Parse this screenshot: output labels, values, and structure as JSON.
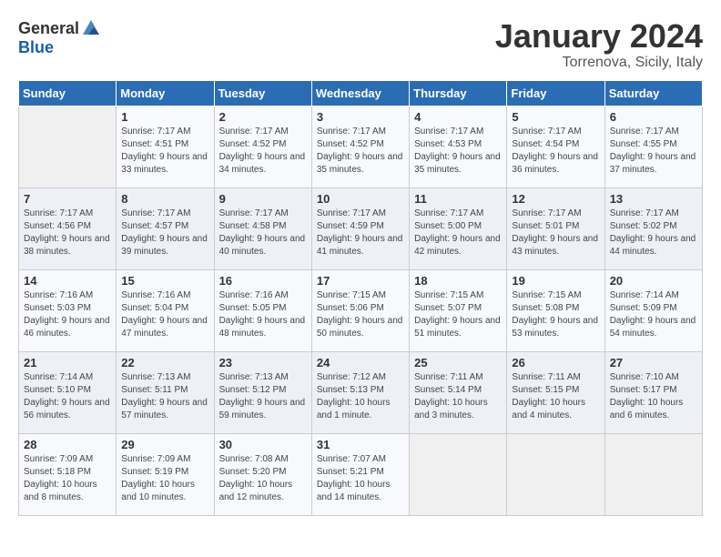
{
  "header": {
    "logo_general": "General",
    "logo_blue": "Blue",
    "month": "January 2024",
    "location": "Torrenova, Sicily, Italy"
  },
  "days_of_week": [
    "Sunday",
    "Monday",
    "Tuesday",
    "Wednesday",
    "Thursday",
    "Friday",
    "Saturday"
  ],
  "weeks": [
    [
      {
        "day": "",
        "sunrise": "",
        "sunset": "",
        "daylight": ""
      },
      {
        "day": "1",
        "sunrise": "Sunrise: 7:17 AM",
        "sunset": "Sunset: 4:51 PM",
        "daylight": "Daylight: 9 hours and 33 minutes."
      },
      {
        "day": "2",
        "sunrise": "Sunrise: 7:17 AM",
        "sunset": "Sunset: 4:52 PM",
        "daylight": "Daylight: 9 hours and 34 minutes."
      },
      {
        "day": "3",
        "sunrise": "Sunrise: 7:17 AM",
        "sunset": "Sunset: 4:52 PM",
        "daylight": "Daylight: 9 hours and 35 minutes."
      },
      {
        "day": "4",
        "sunrise": "Sunrise: 7:17 AM",
        "sunset": "Sunset: 4:53 PM",
        "daylight": "Daylight: 9 hours and 35 minutes."
      },
      {
        "day": "5",
        "sunrise": "Sunrise: 7:17 AM",
        "sunset": "Sunset: 4:54 PM",
        "daylight": "Daylight: 9 hours and 36 minutes."
      },
      {
        "day": "6",
        "sunrise": "Sunrise: 7:17 AM",
        "sunset": "Sunset: 4:55 PM",
        "daylight": "Daylight: 9 hours and 37 minutes."
      }
    ],
    [
      {
        "day": "7",
        "sunrise": "Sunrise: 7:17 AM",
        "sunset": "Sunset: 4:56 PM",
        "daylight": "Daylight: 9 hours and 38 minutes."
      },
      {
        "day": "8",
        "sunrise": "Sunrise: 7:17 AM",
        "sunset": "Sunset: 4:57 PM",
        "daylight": "Daylight: 9 hours and 39 minutes."
      },
      {
        "day": "9",
        "sunrise": "Sunrise: 7:17 AM",
        "sunset": "Sunset: 4:58 PM",
        "daylight": "Daylight: 9 hours and 40 minutes."
      },
      {
        "day": "10",
        "sunrise": "Sunrise: 7:17 AM",
        "sunset": "Sunset: 4:59 PM",
        "daylight": "Daylight: 9 hours and 41 minutes."
      },
      {
        "day": "11",
        "sunrise": "Sunrise: 7:17 AM",
        "sunset": "Sunset: 5:00 PM",
        "daylight": "Daylight: 9 hours and 42 minutes."
      },
      {
        "day": "12",
        "sunrise": "Sunrise: 7:17 AM",
        "sunset": "Sunset: 5:01 PM",
        "daylight": "Daylight: 9 hours and 43 minutes."
      },
      {
        "day": "13",
        "sunrise": "Sunrise: 7:17 AM",
        "sunset": "Sunset: 5:02 PM",
        "daylight": "Daylight: 9 hours and 44 minutes."
      }
    ],
    [
      {
        "day": "14",
        "sunrise": "Sunrise: 7:16 AM",
        "sunset": "Sunset: 5:03 PM",
        "daylight": "Daylight: 9 hours and 46 minutes."
      },
      {
        "day": "15",
        "sunrise": "Sunrise: 7:16 AM",
        "sunset": "Sunset: 5:04 PM",
        "daylight": "Daylight: 9 hours and 47 minutes."
      },
      {
        "day": "16",
        "sunrise": "Sunrise: 7:16 AM",
        "sunset": "Sunset: 5:05 PM",
        "daylight": "Daylight: 9 hours and 48 minutes."
      },
      {
        "day": "17",
        "sunrise": "Sunrise: 7:15 AM",
        "sunset": "Sunset: 5:06 PM",
        "daylight": "Daylight: 9 hours and 50 minutes."
      },
      {
        "day": "18",
        "sunrise": "Sunrise: 7:15 AM",
        "sunset": "Sunset: 5:07 PM",
        "daylight": "Daylight: 9 hours and 51 minutes."
      },
      {
        "day": "19",
        "sunrise": "Sunrise: 7:15 AM",
        "sunset": "Sunset: 5:08 PM",
        "daylight": "Daylight: 9 hours and 53 minutes."
      },
      {
        "day": "20",
        "sunrise": "Sunrise: 7:14 AM",
        "sunset": "Sunset: 5:09 PM",
        "daylight": "Daylight: 9 hours and 54 minutes."
      }
    ],
    [
      {
        "day": "21",
        "sunrise": "Sunrise: 7:14 AM",
        "sunset": "Sunset: 5:10 PM",
        "daylight": "Daylight: 9 hours and 56 minutes."
      },
      {
        "day": "22",
        "sunrise": "Sunrise: 7:13 AM",
        "sunset": "Sunset: 5:11 PM",
        "daylight": "Daylight: 9 hours and 57 minutes."
      },
      {
        "day": "23",
        "sunrise": "Sunrise: 7:13 AM",
        "sunset": "Sunset: 5:12 PM",
        "daylight": "Daylight: 9 hours and 59 minutes."
      },
      {
        "day": "24",
        "sunrise": "Sunrise: 7:12 AM",
        "sunset": "Sunset: 5:13 PM",
        "daylight": "Daylight: 10 hours and 1 minute."
      },
      {
        "day": "25",
        "sunrise": "Sunrise: 7:11 AM",
        "sunset": "Sunset: 5:14 PM",
        "daylight": "Daylight: 10 hours and 3 minutes."
      },
      {
        "day": "26",
        "sunrise": "Sunrise: 7:11 AM",
        "sunset": "Sunset: 5:15 PM",
        "daylight": "Daylight: 10 hours and 4 minutes."
      },
      {
        "day": "27",
        "sunrise": "Sunrise: 7:10 AM",
        "sunset": "Sunset: 5:17 PM",
        "daylight": "Daylight: 10 hours and 6 minutes."
      }
    ],
    [
      {
        "day": "28",
        "sunrise": "Sunrise: 7:09 AM",
        "sunset": "Sunset: 5:18 PM",
        "daylight": "Daylight: 10 hours and 8 minutes."
      },
      {
        "day": "29",
        "sunrise": "Sunrise: 7:09 AM",
        "sunset": "Sunset: 5:19 PM",
        "daylight": "Daylight: 10 hours and 10 minutes."
      },
      {
        "day": "30",
        "sunrise": "Sunrise: 7:08 AM",
        "sunset": "Sunset: 5:20 PM",
        "daylight": "Daylight: 10 hours and 12 minutes."
      },
      {
        "day": "31",
        "sunrise": "Sunrise: 7:07 AM",
        "sunset": "Sunset: 5:21 PM",
        "daylight": "Daylight: 10 hours and 14 minutes."
      },
      {
        "day": "",
        "sunrise": "",
        "sunset": "",
        "daylight": ""
      },
      {
        "day": "",
        "sunrise": "",
        "sunset": "",
        "daylight": ""
      },
      {
        "day": "",
        "sunrise": "",
        "sunset": "",
        "daylight": ""
      }
    ]
  ]
}
